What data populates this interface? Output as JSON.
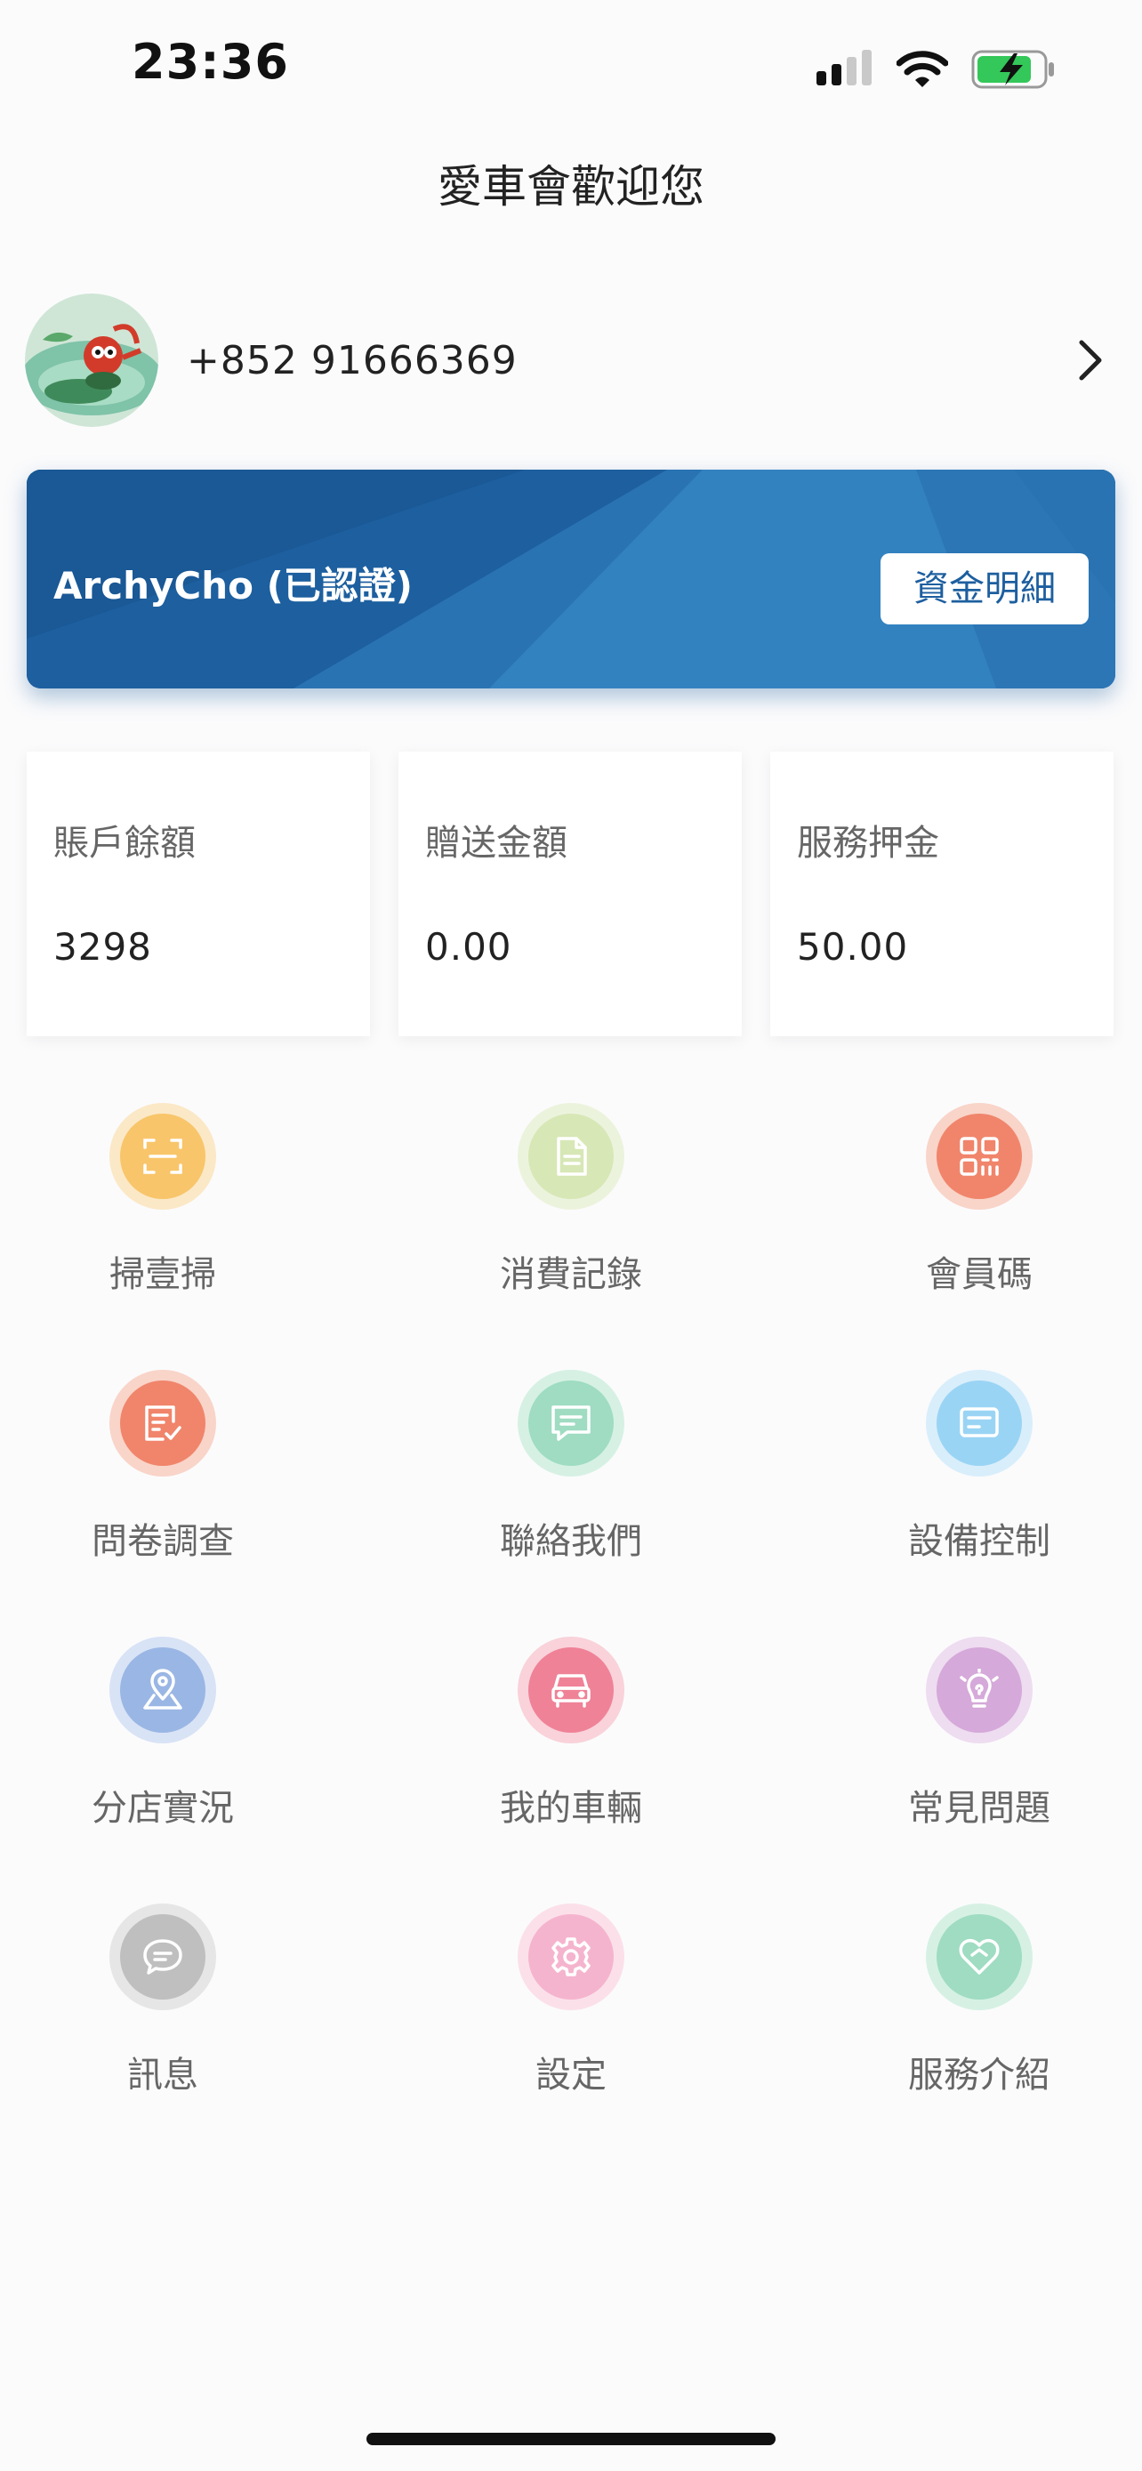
{
  "status_bar": {
    "time": "23:36"
  },
  "header": {
    "title": "愛車會歡迎您"
  },
  "profile": {
    "phone": "+852 91666369"
  },
  "banner": {
    "name": "ArchyCho (已認證)",
    "funds_button": "資金明細"
  },
  "stats": [
    {
      "label": "賬戶餘額",
      "value": "3298"
    },
    {
      "label": "贈送金額",
      "value": "0.00"
    },
    {
      "label": "服務押金",
      "value": "50.00"
    }
  ],
  "menu": [
    {
      "label": "掃壹掃",
      "icon": "scan-icon",
      "color": "#f8c56a",
      "ring": "#fbe8c6"
    },
    {
      "label": "消費記錄",
      "icon": "document-icon",
      "color": "#d7e7b6",
      "ring": "#ecf3dd"
    },
    {
      "label": "會員碼",
      "icon": "qr-code-icon",
      "color": "#f0856b",
      "ring": "#f9d4c9"
    },
    {
      "label": "問卷調查",
      "icon": "survey-icon",
      "color": "#f0856b",
      "ring": "#f9d4c9"
    },
    {
      "label": "聯絡我們",
      "icon": "chat-icon",
      "color": "#9fdcc2",
      "ring": "#d6f1e4"
    },
    {
      "label": "設備控制",
      "icon": "device-icon",
      "color": "#9ad4f4",
      "ring": "#d9eefb"
    },
    {
      "label": "分店實況",
      "icon": "map-pin-icon",
      "color": "#9ab6e4",
      "ring": "#d8e3f6"
    },
    {
      "label": "我的車輛",
      "icon": "car-icon",
      "color": "#ef8297",
      "ring": "#f9d2da"
    },
    {
      "label": "常見問題",
      "icon": "lightbulb-icon",
      "color": "#d5a9d9",
      "ring": "#eedcf0"
    },
    {
      "label": "訊息",
      "icon": "message-icon",
      "color": "#bfbfbf",
      "ring": "#e6e6e6"
    },
    {
      "label": "設定",
      "icon": "gear-icon",
      "color": "#f5b4cd",
      "ring": "#fbe0ea"
    },
    {
      "label": "服務介紹",
      "icon": "heart-icon",
      "color": "#9fdcc2",
      "ring": "#d6f1e4"
    }
  ]
}
